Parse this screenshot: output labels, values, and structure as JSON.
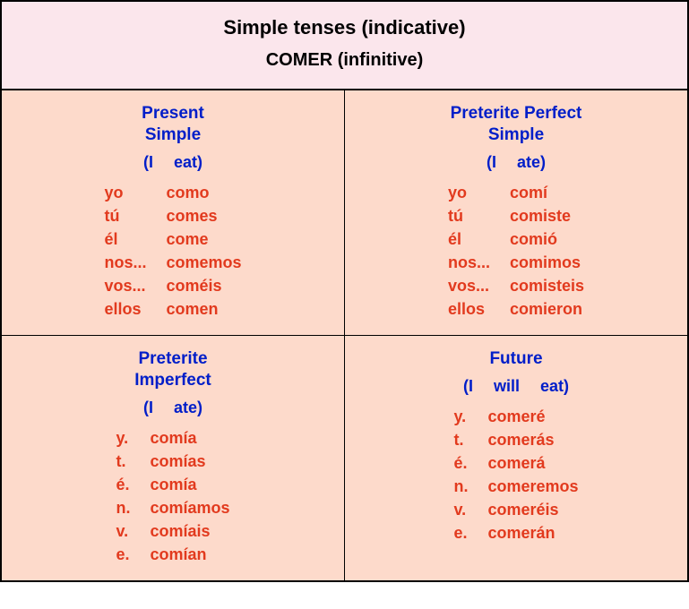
{
  "header": {
    "title": "Simple tenses (indicative)",
    "subtitle": "COMER (infinitive)"
  },
  "tenses": [
    {
      "name_lines": [
        "Present",
        "Simple"
      ],
      "translation": "(I eat)",
      "rows": [
        {
          "p": "yo",
          "f": "como"
        },
        {
          "p": "tú",
          "f": "comes"
        },
        {
          "p": "él",
          "f": "come"
        },
        {
          "p": "nos...",
          "f": "comemos"
        },
        {
          "p": "vos...",
          "f": "coméis"
        },
        {
          "p": "ellos",
          "f": "comen"
        }
      ]
    },
    {
      "name_lines": [
        "Preterite Perfect",
        "Simple"
      ],
      "translation": "(I ate)",
      "rows": [
        {
          "p": "yo",
          "f": "comí"
        },
        {
          "p": "tú",
          "f": "comiste"
        },
        {
          "p": "él",
          "f": "comió"
        },
        {
          "p": "nos...",
          "f": "comimos"
        },
        {
          "p": "vos...",
          "f": "comisteis"
        },
        {
          "p": "ellos",
          "f": "comieron"
        }
      ]
    },
    {
      "name_lines": [
        "Preterite",
        "Imperfect"
      ],
      "translation": "(I ate)",
      "rows": [
        {
          "p": "y.",
          "f": "comía"
        },
        {
          "p": "t.",
          "f": "comías"
        },
        {
          "p": "é.",
          "f": "comía"
        },
        {
          "p": "n.",
          "f": "comíamos"
        },
        {
          "p": "v.",
          "f": "comíais"
        },
        {
          "p": "e.",
          "f": "comían"
        }
      ]
    },
    {
      "name_lines": [
        "Future"
      ],
      "translation": "(I will eat)",
      "rows": [
        {
          "p": "y.",
          "f": "comeré"
        },
        {
          "p": "t.",
          "f": "comerás"
        },
        {
          "p": "é.",
          "f": "comerá"
        },
        {
          "p": "n.",
          "f": "comeremos"
        },
        {
          "p": "v.",
          "f": "comeréis"
        },
        {
          "p": "e.",
          "f": "comerán"
        }
      ]
    }
  ]
}
